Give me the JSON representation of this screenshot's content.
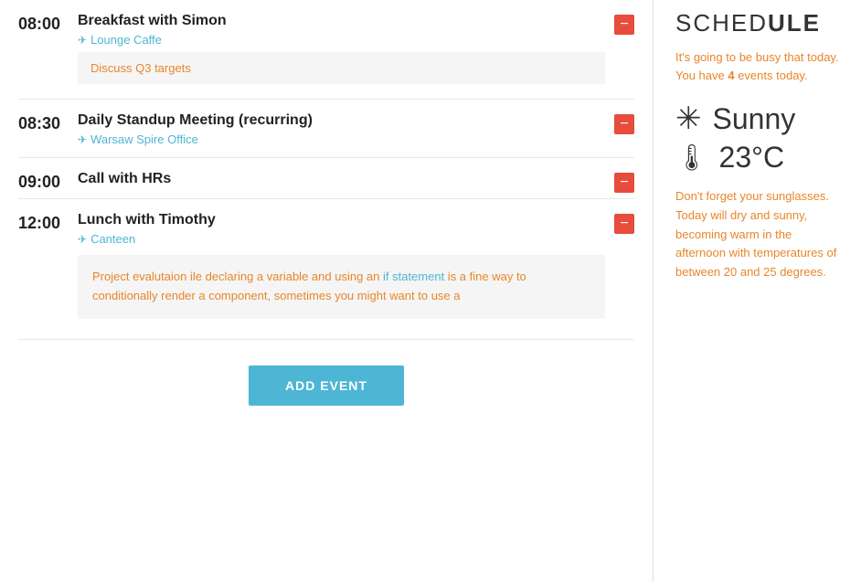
{
  "schedule": {
    "title_light": "SCHED",
    "title_bold": "ULE",
    "full_title": "SCHEDULE",
    "busy_text": "It's going to be busy that today. You have ",
    "event_count": "4",
    "busy_text_end": " events today."
  },
  "weather": {
    "condition": "Sunny",
    "temperature": "23°C",
    "description": "Don't forget your sunglasses. Today will dry and sunny, becoming warm in the afternoon with temperatures of between 20 and 25 degrees."
  },
  "events": [
    {
      "time": "08:00",
      "title": "Breakfast with Simon",
      "location": "Lounge Caffe",
      "note": "Discuss Q3 targets"
    },
    {
      "time": "08:30",
      "title": "Daily Standup Meeting (recurring)",
      "location": "Warsaw Spire Office",
      "note": null
    },
    {
      "time": "09:00",
      "title": "Call with HRs",
      "location": null,
      "note": null
    },
    {
      "time": "12:00",
      "title": "Lunch with Timothy",
      "location": "Canteen",
      "note_multiline": "Project evalutaion ile declaring a variable and using an if statement is a fine way to conditionally render a component, sometimes you might want to use a"
    }
  ],
  "add_event_button": "ADD EVENT"
}
